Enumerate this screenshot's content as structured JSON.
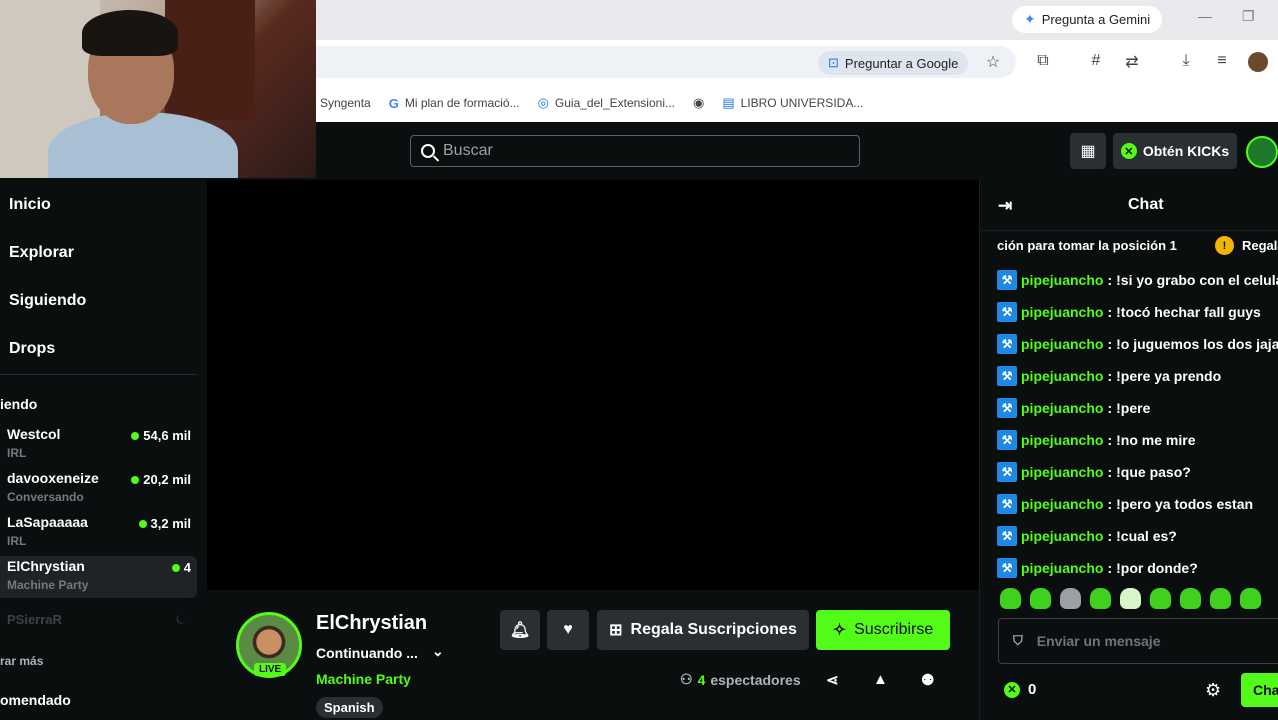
{
  "browser": {
    "gemini_button": "Pregunta a Gemini",
    "ask_google": "Preguntar a Google",
    "bookmarks": [
      {
        "label": "Syngenta",
        "icon": "none"
      },
      {
        "label": "Mi plan de formació...",
        "icon": "google-g-icon"
      },
      {
        "label": "Guia_del_Extensioni...",
        "icon": "globe-icon"
      },
      {
        "label": "",
        "icon": "globe-icon"
      },
      {
        "label": "LIBRO UNIVERSIDA...",
        "icon": "doc-icon"
      }
    ]
  },
  "header": {
    "search_placeholder": "Buscar",
    "kicks_button": "Obtén KICKs"
  },
  "sidebar": {
    "nav": [
      "Inicio",
      "Explorar",
      "Siguiendo",
      "Drops"
    ],
    "following_heading": "iendo",
    "channels": [
      {
        "name": "Westcol",
        "category": "IRL",
        "viewers": "54,6 mil"
      },
      {
        "name": "davooxeneize",
        "category": "Conversando",
        "viewers": "20,2 mil"
      },
      {
        "name": "LaSapaaaaa",
        "category": "IRL",
        "viewers": "3,2 mil"
      },
      {
        "name": "ElChrystian",
        "category": "Machine Party",
        "viewers": "4"
      }
    ],
    "offline_channel": "PSierraR",
    "show_more": "rar más",
    "recommended": "omendado"
  },
  "stream": {
    "streamer": "ElChrystian",
    "live_badge": "LIVE",
    "title": "Continuando ...",
    "category": "Machine Party",
    "language": "Spanish",
    "gift_subs": "Regala Suscripciones",
    "subscribe": "Suscribirse",
    "viewer_count": "4",
    "viewers_label": "espectadores"
  },
  "chat": {
    "title": "Chat",
    "pinned_text": "ción para tomar la posición 1",
    "pinned_badge": "!",
    "pinned_gift": "Regala",
    "messages": [
      {
        "user": "pipejuancho",
        "text": "!si yo grabo con el celular"
      },
      {
        "user": "pipejuancho",
        "text": "!tocó hechar fall guys"
      },
      {
        "user": "pipejuancho",
        "text": "!o juguemos los dos jajaja"
      },
      {
        "user": "pipejuancho",
        "text": "!pere ya prendo"
      },
      {
        "user": "pipejuancho",
        "text": "!pere"
      },
      {
        "user": "pipejuancho",
        "text": "!no me mire"
      },
      {
        "user": "pipejuancho",
        "text": "!que paso?"
      },
      {
        "user": "pipejuancho",
        "text": "!pero ya todos estan"
      },
      {
        "user": "pipejuancho",
        "text": "!cual es?"
      },
      {
        "user": "pipejuancho",
        "text": "!por donde?"
      }
    ],
    "input_placeholder": "Enviar un mensaje",
    "kicks_balance": "0",
    "send_button": "Chat"
  },
  "colors": {
    "brand_green": "#53fc18",
    "background": "#0b0e0f",
    "button_gray": "#2a2f33"
  }
}
